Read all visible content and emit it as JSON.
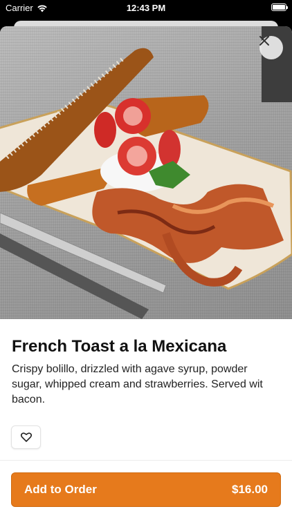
{
  "status_bar": {
    "carrier": "Carrier",
    "time": "12:43 PM"
  },
  "item": {
    "title": "French Toast a la Mexicana",
    "description": "Crispy bolillo, drizzled with agave syrup, powder sugar, whipped cream and strawberries. Served wit bacon.",
    "image_icon": "food-photo"
  },
  "actions": {
    "close_icon": "close-icon",
    "favorite_icon": "heart-icon",
    "add_to_order_label": "Add to Order",
    "price": "$16.00"
  },
  "colors": {
    "accent": "#e67a1c",
    "status_bar_bg": "#000000"
  }
}
